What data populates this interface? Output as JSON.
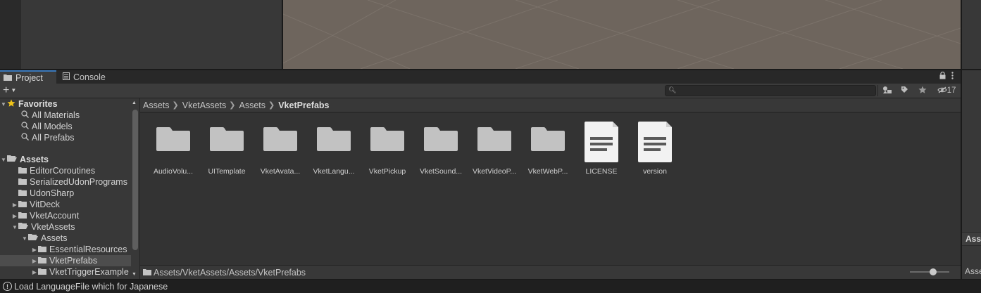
{
  "tabs": [
    {
      "label": "Project",
      "icon": "folder-icon",
      "active": true
    },
    {
      "label": "Console",
      "icon": "console-icon",
      "active": false
    }
  ],
  "toolbar": {
    "add_label": "+",
    "search_placeholder": "",
    "hidden_count": "17"
  },
  "tree": {
    "favorites": {
      "label": "Favorites",
      "items": [
        "All Materials",
        "All Models",
        "All Prefabs"
      ]
    },
    "assets": {
      "label": "Assets",
      "items": [
        {
          "label": "EditorCoroutines",
          "depth": 1,
          "arrow": ""
        },
        {
          "label": "SerializedUdonPrograms",
          "depth": 1,
          "arrow": ""
        },
        {
          "label": "UdonSharp",
          "depth": 1,
          "arrow": ""
        },
        {
          "label": "VitDeck",
          "depth": 1,
          "arrow": "right"
        },
        {
          "label": "VketAccount",
          "depth": 1,
          "arrow": "right"
        },
        {
          "label": "VketAssets",
          "depth": 1,
          "arrow": "down"
        },
        {
          "label": "Assets",
          "depth": 2,
          "arrow": "down"
        },
        {
          "label": "EssentialResources",
          "depth": 3,
          "arrow": "right"
        },
        {
          "label": "VketPrefabs",
          "depth": 3,
          "arrow": "right",
          "selected": true
        },
        {
          "label": "VketTriggerExample",
          "depth": 3,
          "arrow": "right"
        }
      ]
    }
  },
  "breadcrumb": [
    "Assets",
    "VketAssets",
    "Assets",
    "VketPrefabs"
  ],
  "grid_items": [
    {
      "label": "AudioVolu...",
      "type": "folder"
    },
    {
      "label": "UITemplate",
      "type": "folder"
    },
    {
      "label": "VketAvata...",
      "type": "folder"
    },
    {
      "label": "VketLangu...",
      "type": "folder"
    },
    {
      "label": "VketPickup",
      "type": "folder"
    },
    {
      "label": "VketSound...",
      "type": "folder"
    },
    {
      "label": "VketVideoP...",
      "type": "folder"
    },
    {
      "label": "VketWebP...",
      "type": "folder"
    },
    {
      "label": "LICENSE",
      "type": "file"
    },
    {
      "label": "version",
      "type": "file"
    }
  ],
  "path_bar": {
    "path": "Assets/VketAssets/Assets/VketPrefabs"
  },
  "zoom_level": 0.6,
  "inspector": {
    "header": "Asse",
    "sub": "Asse"
  },
  "status": {
    "message": "Load LanguageFile which for Japanese"
  },
  "colors": {
    "accent": "#3a79bb",
    "folder": "#c2c2c2",
    "scene": "#6e655d"
  }
}
